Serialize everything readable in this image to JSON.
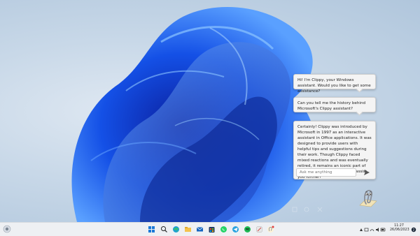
{
  "chat": {
    "greeting": "Hi! I'm Clippy, your Windows assistant. Would you like to get some assistance?",
    "user_message": "Can you tell me the history behind Microsoft's Clippy assistant?",
    "answer": "Certainly! Clippy was introduced by Microsoft in 1997 as an interactive assistant in Office applications. It was designed to provide users with helpful tips and suggestions during their work. Though Clippy faced mixed reactions and was eventually retired, it remains an iconic part of Microsoft's history. How can I assist you further?",
    "input_placeholder": "Ask me anything"
  },
  "taskbar": {
    "time": "11:27",
    "date": "26/06/2023",
    "apps": [
      "start-icon",
      "search-icon",
      "taskview-icon",
      "edge-icon",
      "file-explorer-icon",
      "mail-icon",
      "store-icon",
      "telegram-icon",
      "whatsapp-icon",
      "spotify-icon",
      "app-icon",
      "clippy-app-icon"
    ]
  },
  "colors": {
    "accent": "#1d5fe0",
    "wallpaper_dark": "#0a2fb4",
    "wallpaper_light": "#3c8cf5"
  }
}
